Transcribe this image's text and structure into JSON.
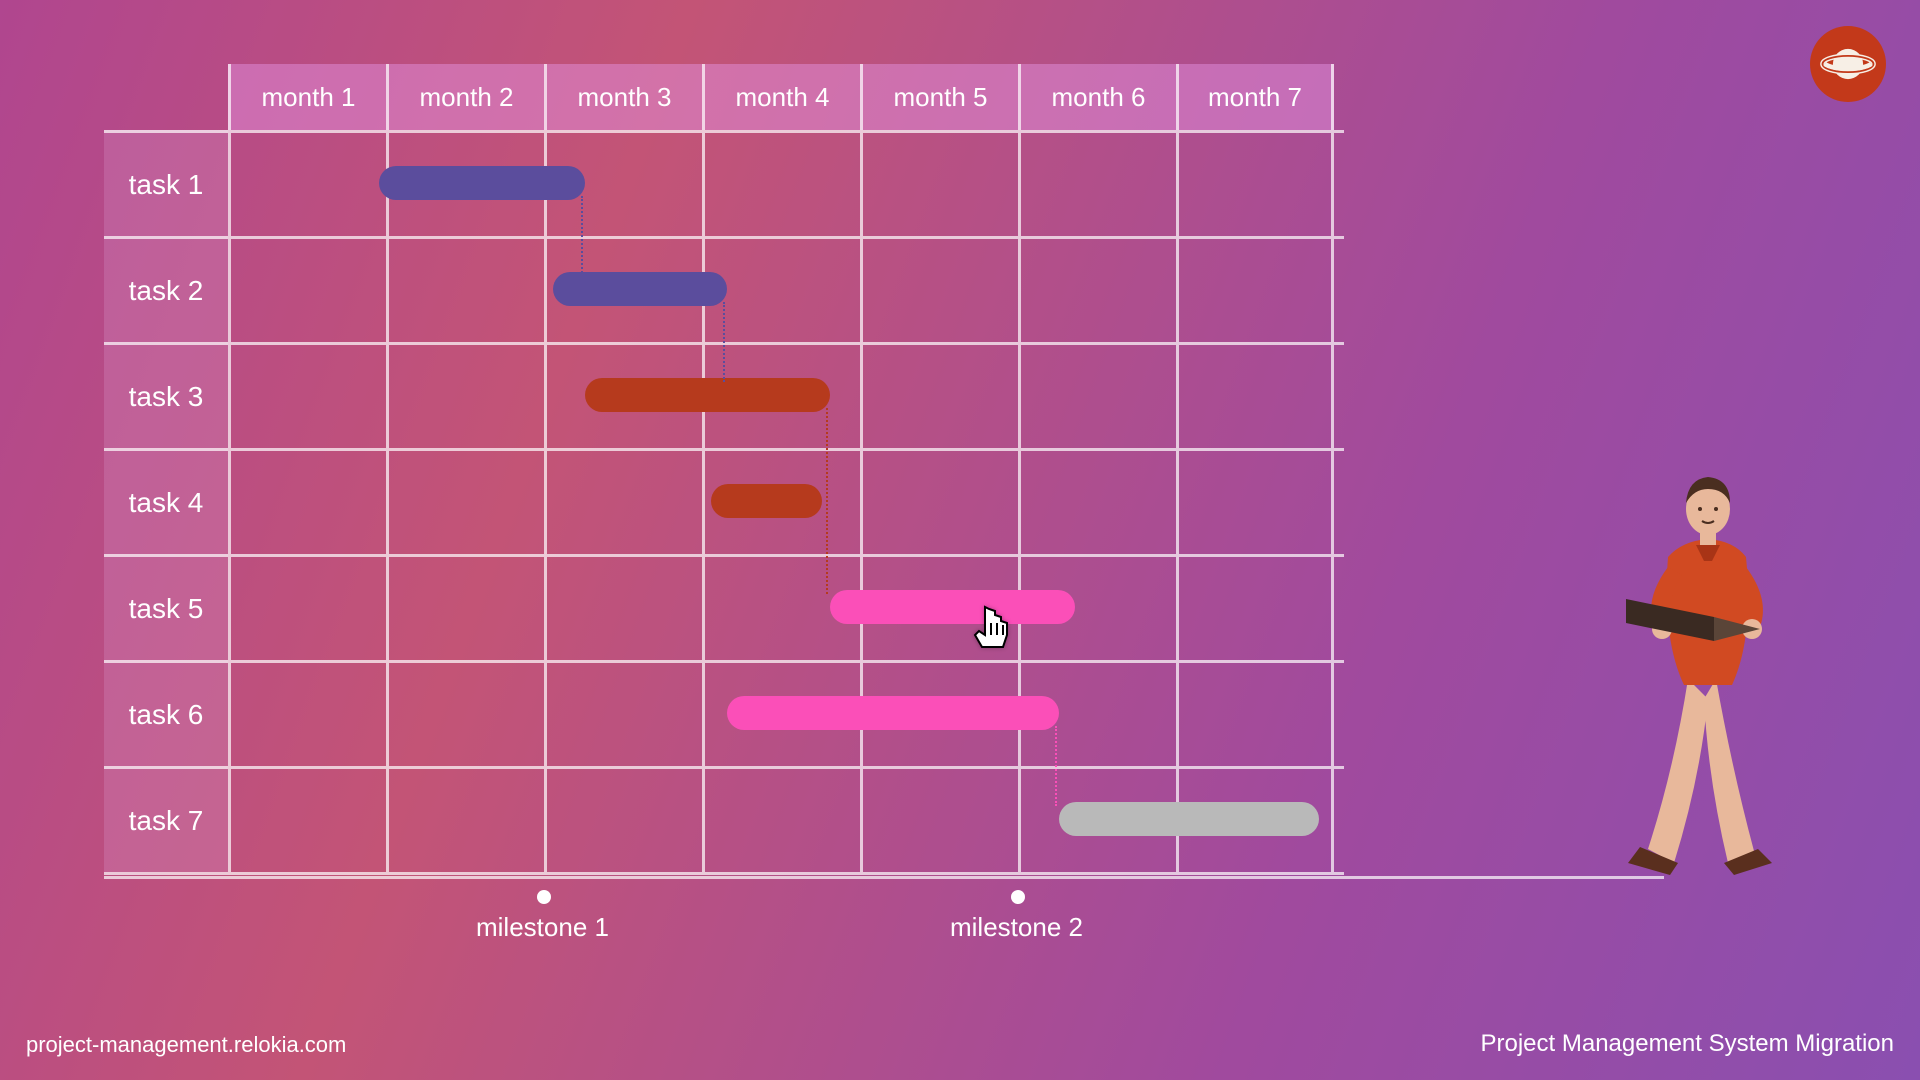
{
  "logo": {
    "name": "planet-logo"
  },
  "footer": {
    "left": "project-management.relokia.com",
    "right": "Project Management System Migration"
  },
  "gantt": {
    "columns": [
      "month 1",
      "month 2",
      "month 3",
      "month 4",
      "month 5",
      "month 6",
      "month 7"
    ],
    "rows": [
      "task 1",
      "task 2",
      "task 3",
      "task 4",
      "task 5",
      "task 6",
      "task 7"
    ],
    "milestones": [
      {
        "label": "milestone 1",
        "at_month": 2.0
      },
      {
        "label": "milestone 2",
        "at_month": 5.0
      }
    ]
  },
  "chart_data": {
    "type": "bar",
    "subtype": "gantt",
    "title": "",
    "xlabel": "month",
    "ylabel": "task",
    "categories": [
      "task 1",
      "task 2",
      "task 3",
      "task 4",
      "task 5",
      "task 6",
      "task 7"
    ],
    "x_columns": [
      "month 1",
      "month 2",
      "month 3",
      "month 4",
      "month 5",
      "month 6",
      "month 7"
    ],
    "bars": [
      {
        "task": "task 1",
        "start": 0.3,
        "end": 1.6,
        "color": "#5b4d9d",
        "group": "A"
      },
      {
        "task": "task 2",
        "start": 1.4,
        "end": 2.5,
        "color": "#5b4d9d",
        "group": "A"
      },
      {
        "task": "task 3",
        "start": 1.6,
        "end": 3.15,
        "color": "#b63a1d",
        "group": "B"
      },
      {
        "task": "task 4",
        "start": 2.4,
        "end": 3.1,
        "color": "#b63a1d",
        "group": "B"
      },
      {
        "task": "task 5",
        "start": 3.15,
        "end": 4.7,
        "color": "#fb4fb8",
        "group": "C"
      },
      {
        "task": "task 6",
        "start": 2.5,
        "end": 4.6,
        "color": "#fb4fb8",
        "group": "C"
      },
      {
        "task": "task 7",
        "start": 4.6,
        "end": 6.25,
        "color": "#b9b9b9",
        "group": "D"
      }
    ],
    "dependencies": [
      {
        "from": "task 1",
        "to": "task 2",
        "color": "#5b4d9d"
      },
      {
        "from": "task 2",
        "to": "task 3",
        "color": "#5b4d9d"
      },
      {
        "from": "task 3",
        "to": "task 5",
        "color": "#b63a1d"
      },
      {
        "from": "task 6",
        "to": "task 7",
        "color": "#fb4fb8"
      }
    ],
    "milestones": [
      {
        "label": "milestone 1",
        "x": 2.0
      },
      {
        "label": "milestone 2",
        "x": 5.0
      }
    ],
    "xlim": [
      0,
      7
    ],
    "cursor_on": "task 5"
  }
}
